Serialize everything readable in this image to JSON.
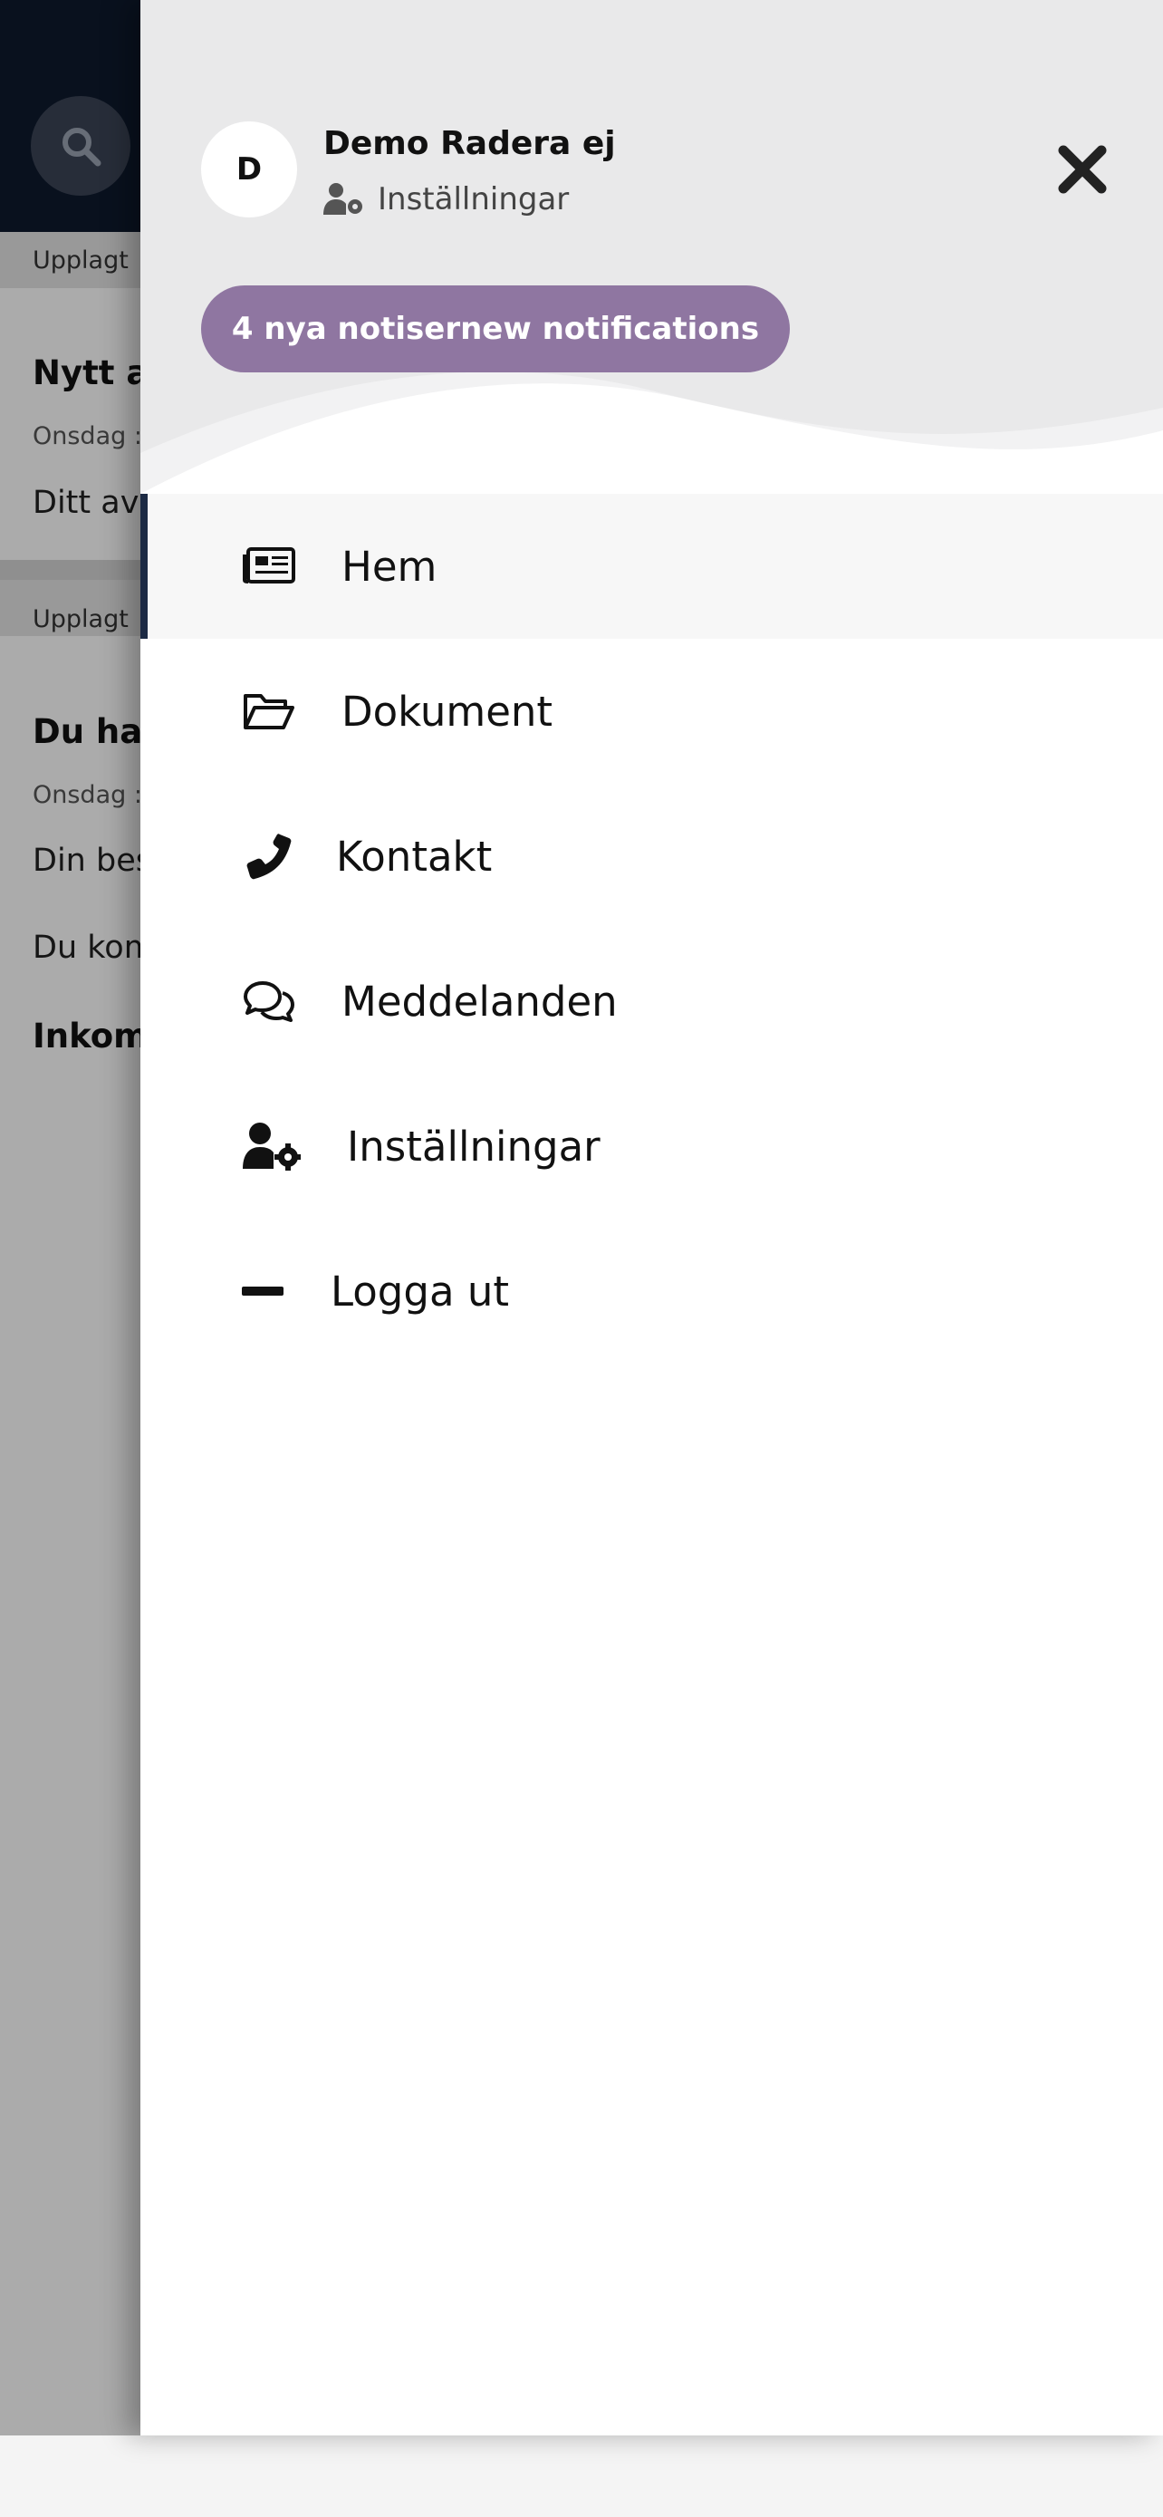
{
  "background": {
    "search_icon": "search-icon",
    "upplagt_1": "Upplagt",
    "card1_title": "Nytt a",
    "card1_date": "Onsdag :",
    "card1_text": "Ditt av",
    "upplagt_2": "Upplagt",
    "card2_title": "Du har",
    "card2_date": "Onsdag :",
    "card2_text_1": "Din bes",
    "card2_text_2": "Du kom",
    "card2_bold": "Inkom"
  },
  "drawer": {
    "avatar_initial": "D",
    "user_name": "Demo Radera ej",
    "settings_label": "Inställningar",
    "notifications_button": "4 nya notisernew notifications",
    "close_icon": "close-icon",
    "accent_color": "#8f76a1",
    "header_bg": "#e9e9ea",
    "active_indicator_color": "#1c2a44"
  },
  "menu": {
    "items": [
      {
        "label": "Hem",
        "icon": "newspaper-icon",
        "active": true
      },
      {
        "label": "Dokument",
        "icon": "folder-open-icon",
        "active": false
      },
      {
        "label": "Kontakt",
        "icon": "phone-icon",
        "active": false
      },
      {
        "label": "Meddelanden",
        "icon": "comments-icon",
        "active": false
      },
      {
        "label": "Inställningar",
        "icon": "user-cog-icon",
        "active": false
      },
      {
        "label": "Logga ut",
        "icon": "minus-icon",
        "active": false
      }
    ]
  }
}
